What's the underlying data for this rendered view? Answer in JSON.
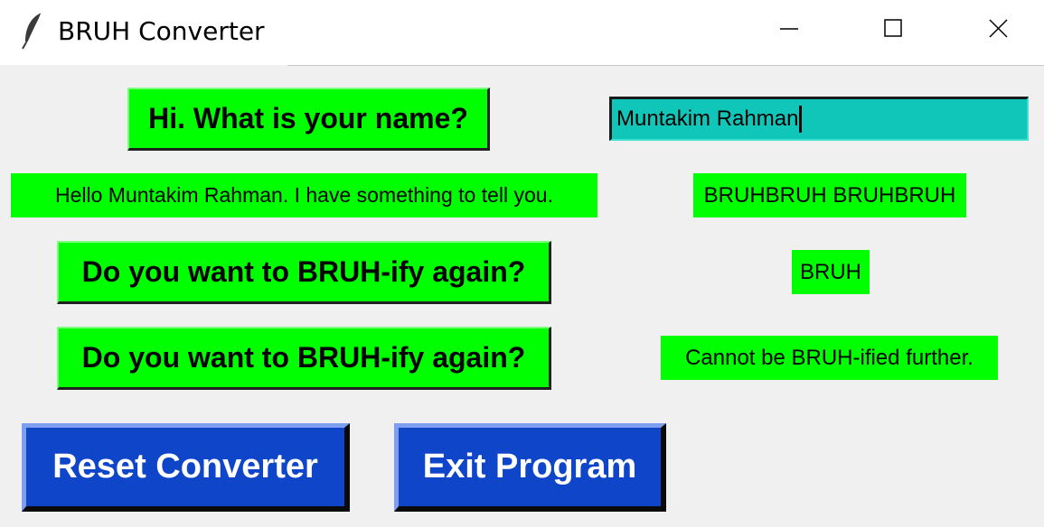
{
  "window": {
    "title": "BRUH Converter",
    "controls": {
      "minimize": "minimize-icon",
      "maximize": "maximize-icon",
      "close": "close-icon"
    }
  },
  "main": {
    "ask_name_button": "Hi. What is your name?",
    "name_input_value": "Muntakim Rahman",
    "greeting_label": "Hello Muntakim Rahman. I have something to tell you.",
    "result_1": "BRUHBRUH BRUHBRUH",
    "again_button_1": "Do you want to BRUH-ify again?",
    "result_2": "BRUH",
    "again_button_2": "Do you want to BRUH-ify again?",
    "result_3": "Cannot be BRUH-ified further.",
    "reset_button": "Reset Converter",
    "exit_button": "Exit Program"
  },
  "colors": {
    "green": "#00ff00",
    "entry_bg": "#0fc6b9",
    "blue_button": "#0f45c8",
    "background": "#f0f0f0"
  }
}
